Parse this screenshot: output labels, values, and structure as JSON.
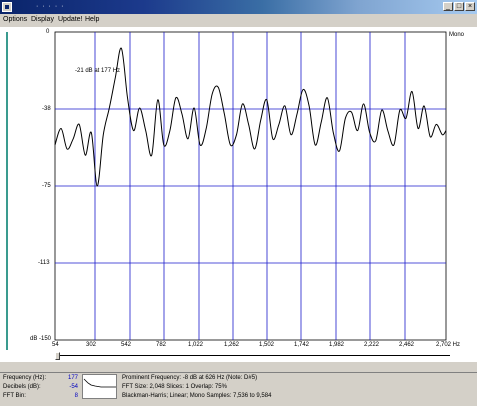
{
  "window": {
    "title": "· · · · ·",
    "minimize_glyph": "_",
    "maximize_glyph": "□",
    "close_glyph": "×"
  },
  "menu": {
    "items": [
      "Options",
      "Display",
      "Update!",
      "Help"
    ]
  },
  "plot": {
    "channel_label": "Mono",
    "annotation": "-21 dB at 177 Hz",
    "y_ticks": [
      "0",
      "-38",
      "-75",
      "-113",
      "dB -150"
    ],
    "x_ticks": [
      "54",
      "302",
      "542",
      "782",
      "1,022",
      "1,262",
      "1,502",
      "1,742",
      "1,982",
      "2,222",
      "2,462",
      "2,702 Hz"
    ]
  },
  "chart_data": {
    "type": "line",
    "xlabel": "",
    "ylabel": "dB",
    "xlim": [
      54,
      2702
    ],
    "ylim": [
      -150,
      0
    ],
    "grid": true,
    "x": [
      54,
      95,
      136,
      177,
      218,
      259,
      300,
      340,
      381,
      422,
      463,
      504,
      545,
      586,
      627,
      668,
      709,
      750,
      791,
      832,
      873,
      914,
      955,
      996,
      1037,
      1078,
      1119,
      1160,
      1201,
      1242,
      1283,
      1324,
      1365,
      1406,
      1447,
      1488,
      1529,
      1570,
      1611,
      1652,
      1693,
      1734,
      1775,
      1816,
      1857,
      1898,
      1939,
      1980,
      2021,
      2062,
      2103,
      2144,
      2185,
      2226,
      2267,
      2308,
      2349,
      2390,
      2431,
      2472,
      2513,
      2554,
      2595,
      2636,
      2677,
      2702
    ],
    "values": [
      -55,
      -47,
      -57,
      -52,
      -45,
      -60,
      -49,
      -75,
      -50,
      -37,
      -22,
      -8,
      -32,
      -48,
      -37,
      -48,
      -60,
      -33,
      -55,
      -48,
      -32,
      -40,
      -52,
      -37,
      -55,
      -47,
      -30,
      -27,
      -40,
      -55,
      -50,
      -35,
      -45,
      -57,
      -43,
      -33,
      -52,
      -45,
      -36,
      -50,
      -40,
      -28,
      -36,
      -55,
      -44,
      -32,
      -49,
      -58,
      -42,
      -39,
      -48,
      -35,
      -49,
      -53,
      -38,
      -48,
      -55,
      -38,
      -42,
      -29,
      -47,
      -36,
      -51,
      -45,
      -50,
      -48
    ],
    "line_color": "#000000",
    "grid_color": "#1a1acc"
  },
  "status": {
    "frequency_label": "Frequency (Hz):",
    "frequency_value": "177",
    "decibels_label": "Decibels (dB):",
    "decibels_value": "-54",
    "fft_bin_label": "FFT Bin:",
    "fft_bin_value": "8",
    "info_line1": "Prominent Frequency: -8 dB at 626 Hz (Note: D#5)",
    "info_line2": "FFT Size: 2,048   Slices: 1   Overlap: 75%",
    "info_line3": "Blackman-Harris; Linear; Mono   Samples: 7,536 to 9,584"
  }
}
